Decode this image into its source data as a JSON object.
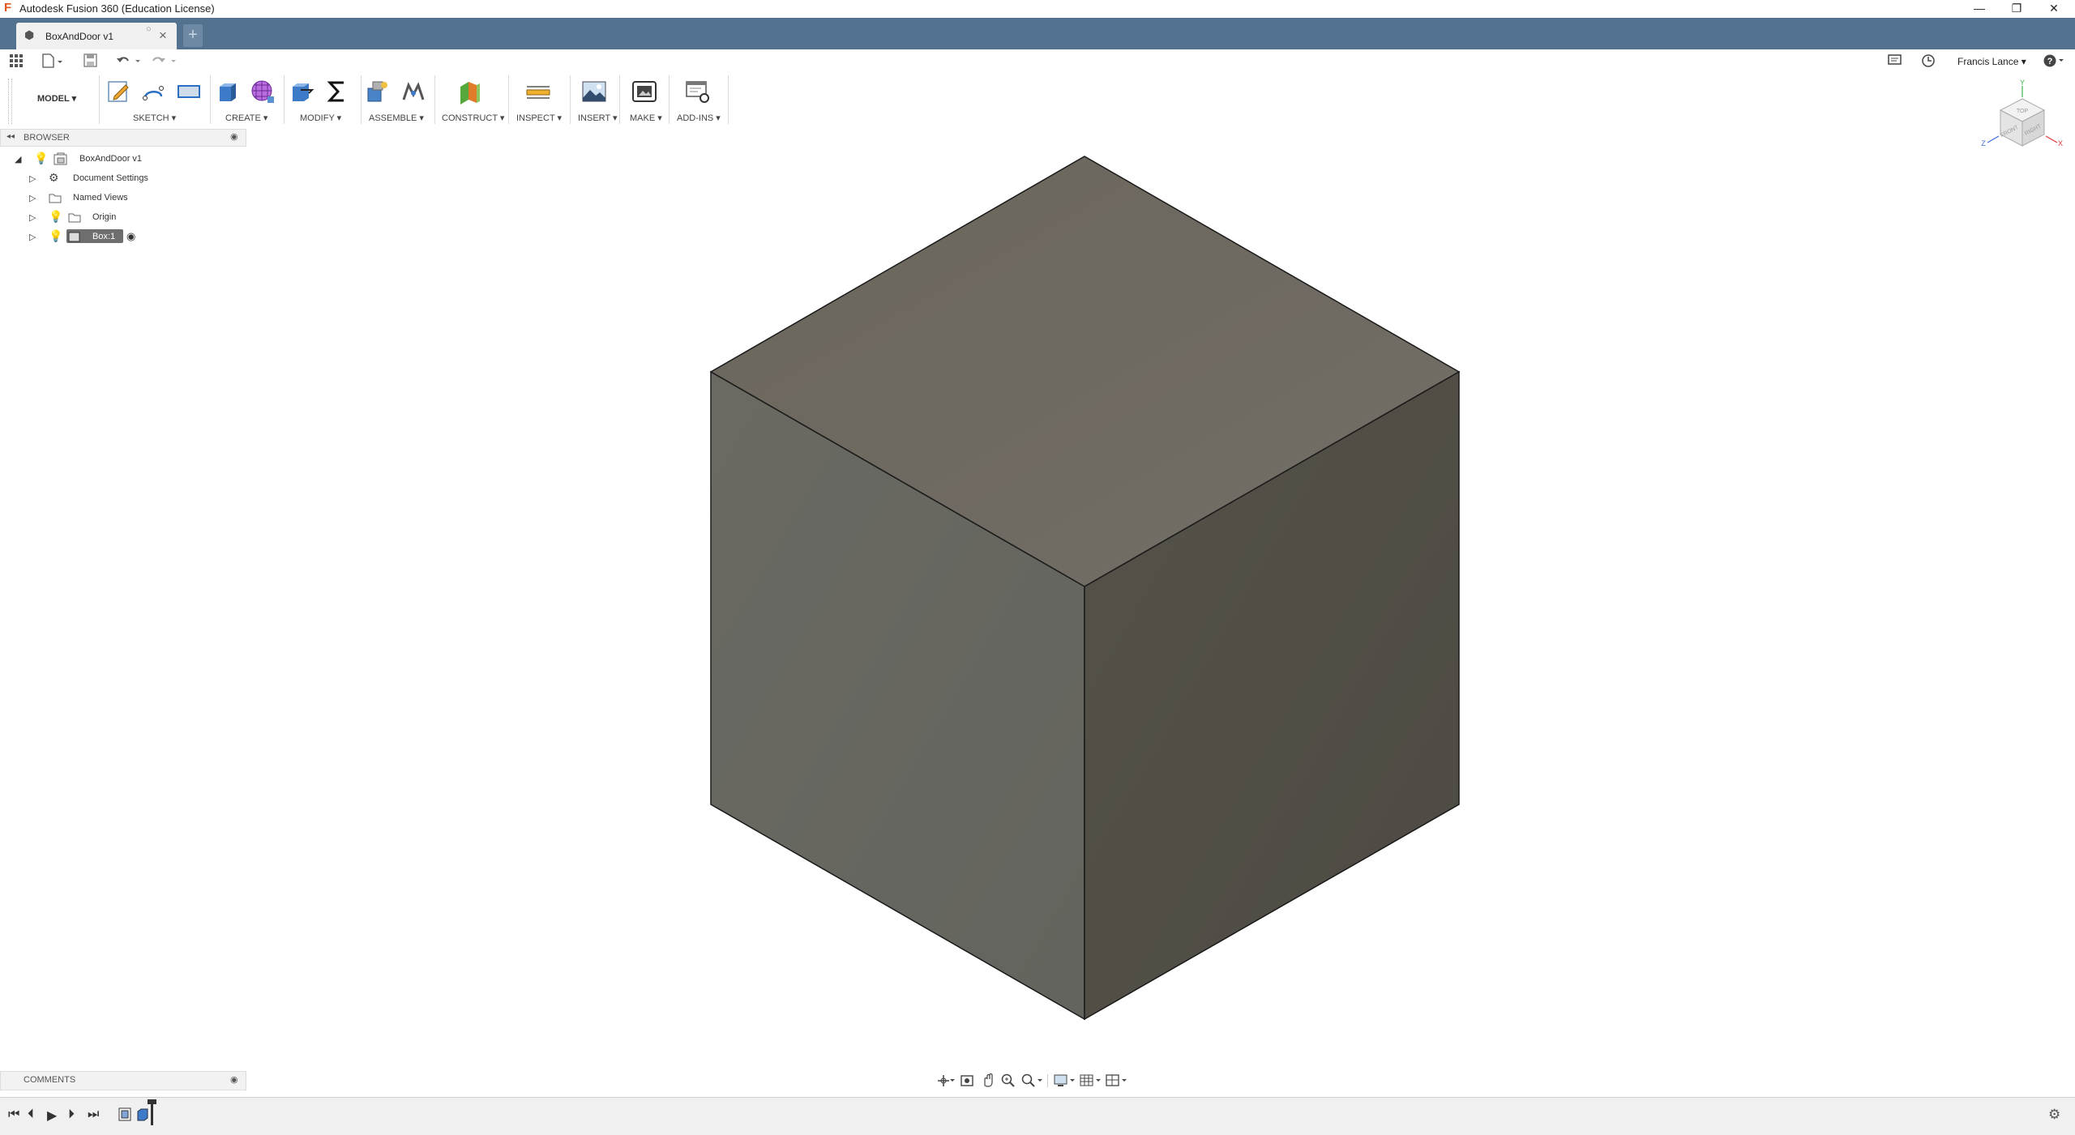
{
  "window": {
    "title": "Autodesk Fusion 360 (Education License)",
    "app_icon": "fusion-logo-icon",
    "controls": [
      "—",
      "❐",
      "✕"
    ]
  },
  "tabs": [
    {
      "label": "BoxAndDoor v1",
      "icon": "document-icon",
      "active": true
    }
  ],
  "quick_access": {
    "user_name": "Francis Lance",
    "icons": [
      "apps-grid-icon",
      "file-menu-icon",
      "save-icon",
      "undo-icon",
      "redo-icon",
      "notifications-icon",
      "job-status-icon",
      "help-icon"
    ]
  },
  "toolbar": {
    "workspace": "MODEL",
    "groups": [
      {
        "label": "SKETCH",
        "icons": [
          "create-sketch-icon",
          "line-icon",
          "rectangle-icon"
        ]
      },
      {
        "label": "CREATE",
        "icons": [
          "extrude-icon",
          "form-icon"
        ]
      },
      {
        "label": "MODIFY",
        "icons": [
          "press-pull-icon",
          "parameters-sigma-icon"
        ]
      },
      {
        "label": "ASSEMBLE",
        "icons": [
          "new-component-icon",
          "joint-icon"
        ]
      },
      {
        "label": "CONSTRUCT",
        "icons": [
          "offset-plane-icon"
        ]
      },
      {
        "label": "INSPECT",
        "icons": [
          "measure-icon"
        ]
      },
      {
        "label": "INSERT",
        "icons": [
          "insert-image-icon"
        ]
      },
      {
        "label": "MAKE",
        "icons": [
          "3d-print-icon"
        ]
      },
      {
        "label": "ADD-INS",
        "icons": [
          "scripts-addins-icon"
        ]
      }
    ]
  },
  "browser": {
    "title": "BROWSER",
    "items": [
      {
        "label": "BoxAndDoor v1",
        "level": 0,
        "expanded": true,
        "has_bulb": true,
        "icon": "component-icon"
      },
      {
        "label": "Document Settings",
        "level": 1,
        "expanded": false,
        "has_bulb": false,
        "icon": "gear-icon"
      },
      {
        "label": "Named Views",
        "level": 1,
        "expanded": false,
        "has_bulb": false,
        "icon": "folder-icon"
      },
      {
        "label": "Origin",
        "level": 1,
        "expanded": false,
        "has_bulb": true,
        "icon": "folder-icon"
      },
      {
        "label": "Box:1",
        "level": 1,
        "expanded": false,
        "has_bulb": true,
        "icon": "component-icon",
        "selected": true
      }
    ]
  },
  "comments": {
    "title": "COMMENTS"
  },
  "viewcube": {
    "faces": [
      "TOP",
      "FRONT",
      "RIGHT"
    ],
    "axes": [
      "Y",
      "Z",
      "X"
    ]
  },
  "colors": {
    "tab_bar": "#52728f",
    "cube_top": "#6e6a60",
    "cube_left": "#686862",
    "cube_right": "#524f47"
  }
}
